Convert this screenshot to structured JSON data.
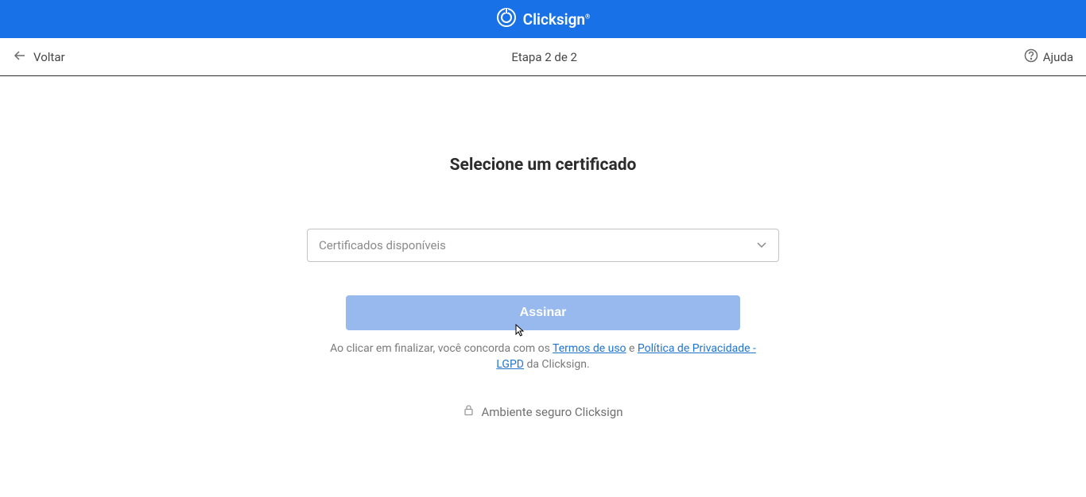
{
  "brand": {
    "name": "Clicksign"
  },
  "subheader": {
    "back_label": "Voltar",
    "step_text": "Etapa 2 de 2",
    "help_label": "Ajuda"
  },
  "main": {
    "title": "Selecione um certificado",
    "dropdown_placeholder": "Certificados disponíveis",
    "sign_button_label": "Assinar",
    "terms": {
      "prefix": "Ao clicar em finalizar, você concorda com os ",
      "tos_link": "Termos de uso",
      "and": " e ",
      "privacy_link": "Política de Privacidade - LGPD",
      "suffix": " da Clicksign."
    },
    "secure_text": "Ambiente seguro Clicksign"
  }
}
